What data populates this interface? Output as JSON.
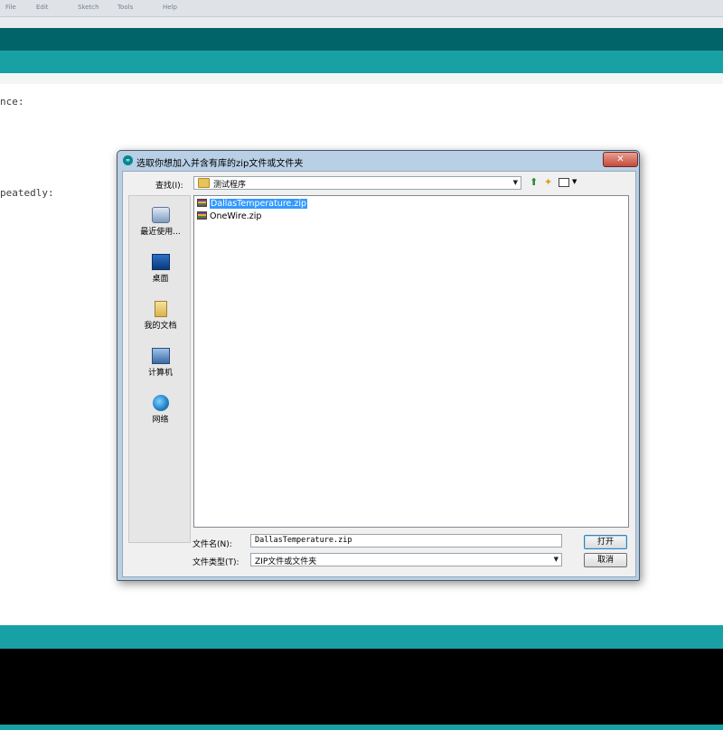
{
  "background": {
    "menu_items": [
      "File",
      "Edit",
      "Sketch",
      "Tools",
      "Help"
    ],
    "code_line_1": "nce:",
    "code_line_2": "peatedly:",
    "colors": {
      "teal_dark": "#006468",
      "teal": "#17a1a5",
      "console": "#000000"
    }
  },
  "dialog": {
    "title": "选取你想加入并含有库的zip文件或文件夹",
    "title_icon": "arduino-icon",
    "close_label": "✕",
    "look_in_label": "查找(I):",
    "look_in_value": "测试程序",
    "places": [
      {
        "label": "最近使用...",
        "icon": "recent-places-icon"
      },
      {
        "label": "桌面",
        "icon": "desktop-icon"
      },
      {
        "label": "我的文档",
        "icon": "documents-icon"
      },
      {
        "label": "计算机",
        "icon": "computer-icon"
      },
      {
        "label": "网络",
        "icon": "network-icon"
      }
    ],
    "files": [
      {
        "name": "DallasTemperature.zip",
        "selected": true
      },
      {
        "name": "OneWire.zip",
        "selected": false
      }
    ],
    "file_name_label": "文件名(N):",
    "file_name_value": "DallasTemperature.zip",
    "file_type_label": "文件类型(T):",
    "file_type_value": "ZIP文件或文件夹",
    "open_label": "打开",
    "cancel_label": "取消"
  }
}
